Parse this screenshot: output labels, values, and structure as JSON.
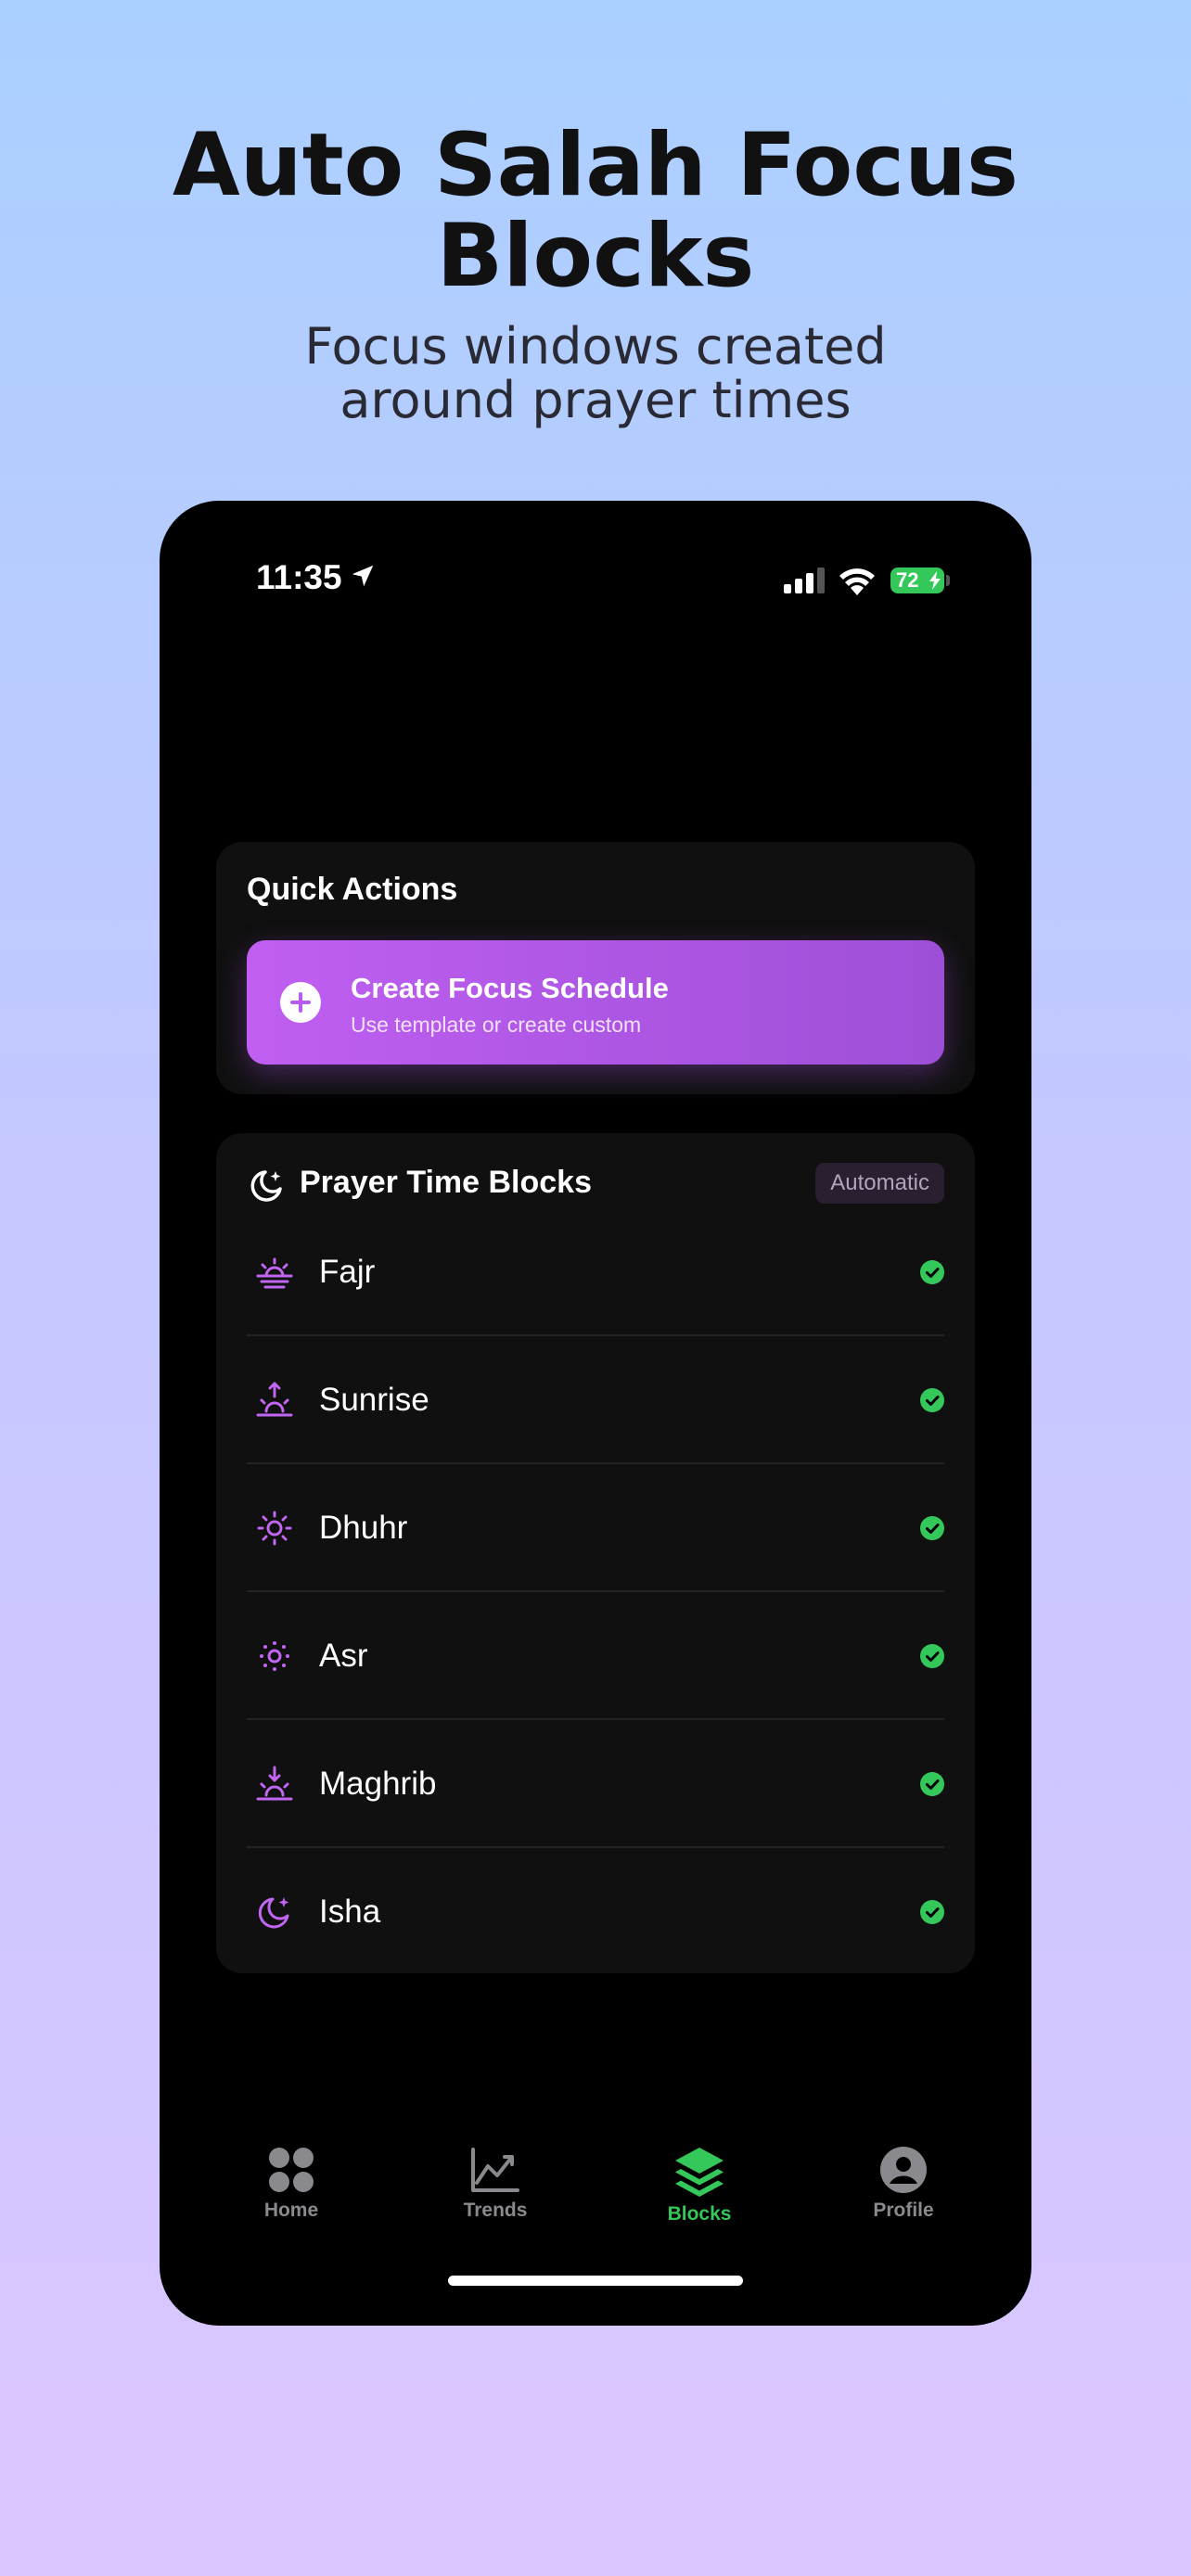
{
  "promo": {
    "headline_line1": "Auto Salah Focus",
    "headline_line2": "Blocks",
    "subhead_line1": "Focus windows created",
    "subhead_line2": "around prayer times"
  },
  "status_bar": {
    "time": "11:35",
    "battery": "72",
    "icons": [
      "location-arrow-icon",
      "cellular-signal-icon",
      "wifi-icon",
      "battery-charging-icon"
    ]
  },
  "quick_actions": {
    "title": "Quick Actions",
    "create_button": {
      "label": "Create Focus Schedule",
      "sublabel": "Use template or create custom",
      "icon": "plus-circle-icon"
    }
  },
  "prayer_blocks": {
    "title": "Prayer Time Blocks",
    "badge": "Automatic",
    "items": [
      {
        "label": "Fajr",
        "icon": "sunrise-horizon-icon",
        "enabled": true
      },
      {
        "label": "Sunrise",
        "icon": "sunrise-up-icon",
        "enabled": true
      },
      {
        "label": "Dhuhr",
        "icon": "sun-icon",
        "enabled": true
      },
      {
        "label": "Asr",
        "icon": "sun-small-icon",
        "enabled": true
      },
      {
        "label": "Maghrib",
        "icon": "sunset-down-icon",
        "enabled": true
      },
      {
        "label": "Isha",
        "icon": "moon-stars-icon",
        "enabled": true
      }
    ]
  },
  "tab_bar": {
    "tabs": [
      {
        "label": "Home",
        "icon": "grid-dots-icon",
        "active": false
      },
      {
        "label": "Trends",
        "icon": "chart-line-icon",
        "active": false
      },
      {
        "label": "Blocks",
        "icon": "layers-icon",
        "active": true
      },
      {
        "label": "Profile",
        "icon": "person-circle-icon",
        "active": false
      }
    ]
  },
  "colors": {
    "background_top": "#aad0ff",
    "background_bottom": "#dcc6ff",
    "accent_purple": "#b65cf0",
    "active_green": "#34c759",
    "card": "#101010"
  }
}
